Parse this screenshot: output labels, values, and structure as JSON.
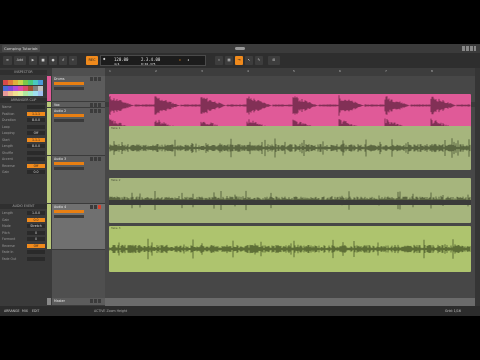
{
  "window": {
    "tab_title": "Comping Tutorial"
  },
  "transport": {
    "add_label": "Add",
    "tempo": "120.00",
    "time_sig": "4/4",
    "position_bars": "2.3.4.00",
    "position_time": "0:02.375",
    "record_label": "REC"
  },
  "inspector": {
    "section1": "ARRANGER CLIP",
    "rows1": [
      {
        "k": "Name",
        "v": ""
      },
      {
        "k": "Position",
        "v": "1.1.1"
      },
      {
        "k": "Duration",
        "v": "8.0.0"
      },
      {
        "k": "Loop",
        "v": ""
      },
      {
        "k": "Looping",
        "v": "Off"
      },
      {
        "k": "Start",
        "v": "1.1.1"
      },
      {
        "k": "Length",
        "v": "8.0.0"
      },
      {
        "k": "Shuffle",
        "v": ""
      },
      {
        "k": "Accent",
        "v": ""
      },
      {
        "k": "Reverse",
        "v": "Off"
      },
      {
        "k": "Gain",
        "v": "0.0"
      }
    ],
    "section2": "AUDIO EVENT",
    "rows2": [
      {
        "k": "Length",
        "v": "1.0.0"
      },
      {
        "k": "Gain",
        "v": "0.0"
      },
      {
        "k": "Mode",
        "v": "Stretch"
      },
      {
        "k": "Pitch",
        "v": "0"
      },
      {
        "k": "Formant",
        "v": "0"
      },
      {
        "k": "Reverse",
        "v": "Off"
      },
      {
        "k": "Fade In",
        "v": ""
      },
      {
        "k": "Fade Out",
        "v": ""
      }
    ]
  },
  "tracks": [
    {
      "name": "Drums",
      "color": "#e05a98"
    },
    {
      "name": "Vox",
      "color": "#b9c87a"
    },
    {
      "name": "Audio 2",
      "color": "#b9c87a"
    },
    {
      "name": "Audio 3",
      "color": "#b9c87a"
    },
    {
      "name": "Audio 4",
      "color": "#b9c87a"
    },
    {
      "name": "Master",
      "color": "#888888"
    }
  ],
  "ruler": [
    "1",
    "2",
    "3",
    "4",
    "5",
    "6",
    "7",
    "8",
    "9"
  ],
  "clips": {
    "take1": "Take 1",
    "take2": "Take 2",
    "take3": "Take 3"
  },
  "bottombar": {
    "left_labels": [
      "ARRANGE",
      "MIX",
      "EDIT"
    ],
    "status": "ACTIVE Zoom Height",
    "zoom": "Grid: 1/16"
  },
  "colors": {
    "accent": "#f08a1c",
    "drum_clip": "#e05a98",
    "vox_clip": "#9bb26a"
  }
}
